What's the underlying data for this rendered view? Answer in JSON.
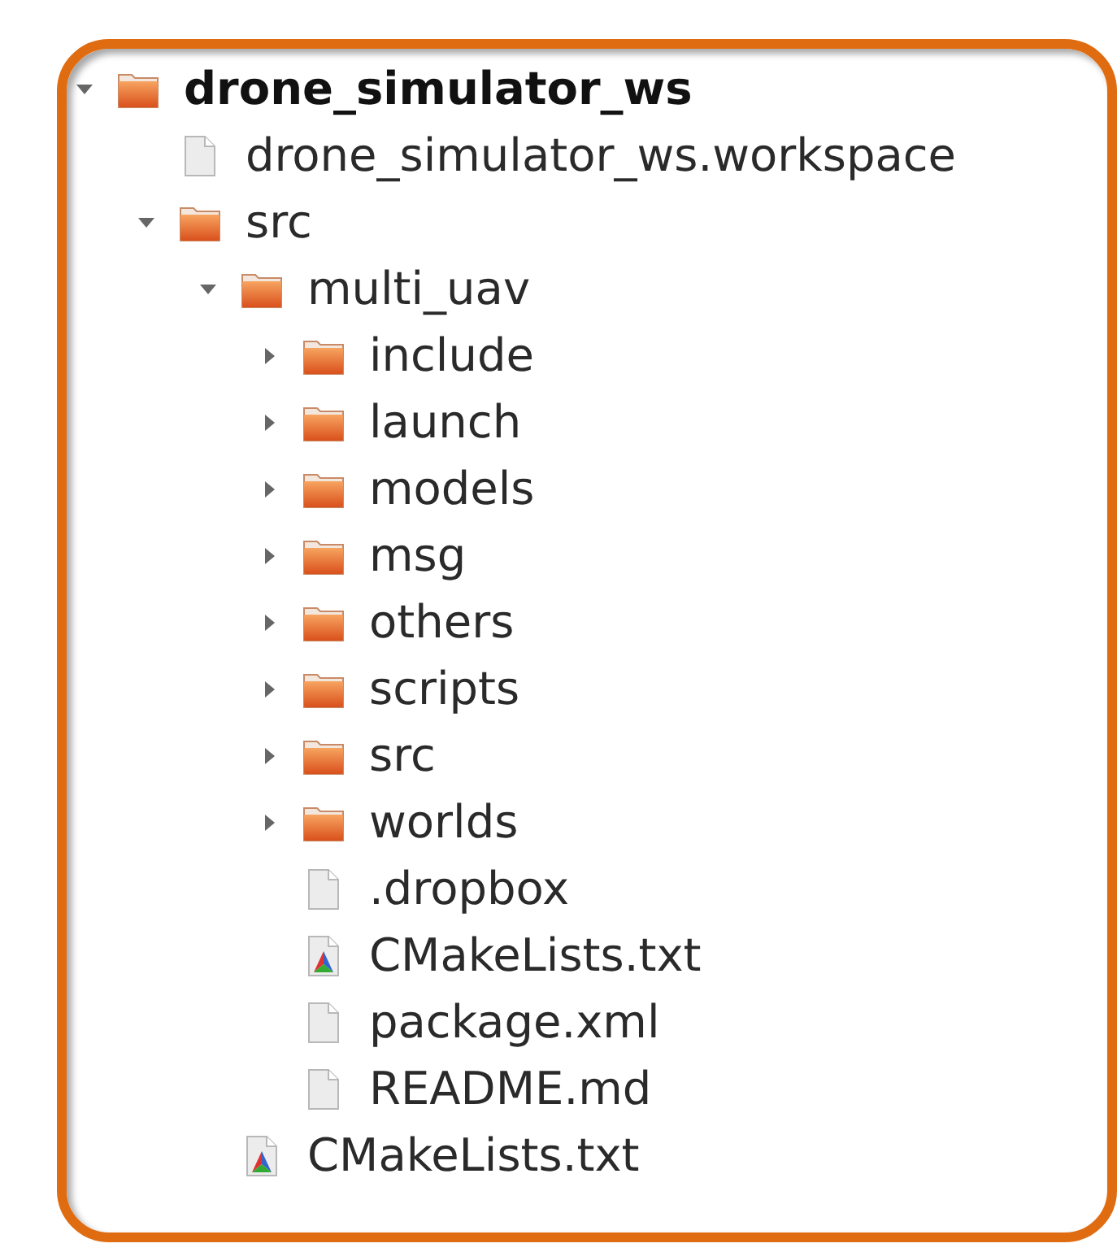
{
  "tree": [
    {
      "kind": "folder",
      "name": "drone_simulator_ws",
      "expanded": true,
      "bold": true,
      "children": [
        {
          "kind": "file",
          "name": "drone_simulator_ws.workspace"
        },
        {
          "kind": "folder",
          "name": "src",
          "expanded": true,
          "children": [
            {
              "kind": "folder",
              "name": "multi_uav",
              "expanded": true,
              "children": [
                {
                  "kind": "folder",
                  "name": "include",
                  "expanded": false
                },
                {
                  "kind": "folder",
                  "name": "launch",
                  "expanded": false
                },
                {
                  "kind": "folder",
                  "name": "models",
                  "expanded": false
                },
                {
                  "kind": "folder",
                  "name": "msg",
                  "expanded": false
                },
                {
                  "kind": "folder",
                  "name": "others",
                  "expanded": false
                },
                {
                  "kind": "folder",
                  "name": "scripts",
                  "expanded": false
                },
                {
                  "kind": "folder",
                  "name": "src",
                  "expanded": false
                },
                {
                  "kind": "folder",
                  "name": "worlds",
                  "expanded": false
                },
                {
                  "kind": "file",
                  "name": ".dropbox"
                },
                {
                  "kind": "cmake",
                  "name": "CMakeLists.txt"
                },
                {
                  "kind": "file",
                  "name": "package.xml"
                },
                {
                  "kind": "file",
                  "name": "README.md"
                }
              ]
            },
            {
              "kind": "cmake",
              "name": "CMakeLists.txt"
            }
          ]
        }
      ]
    }
  ]
}
